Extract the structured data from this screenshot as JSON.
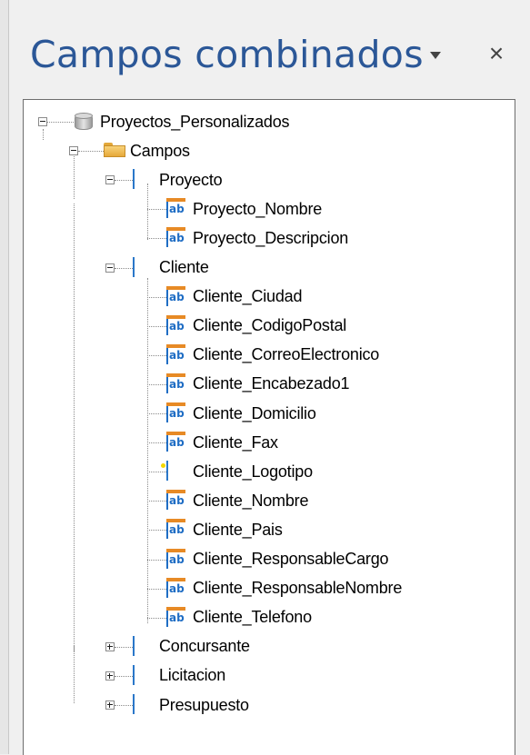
{
  "panel": {
    "title": "Campos combinados",
    "dropdown_icon": "chevron-down-icon",
    "close_label": "×"
  },
  "tree": {
    "root": {
      "label": "Proyectos_Personalizados",
      "icon": "database-icon"
    },
    "campos": {
      "label": "Campos",
      "icon": "folder-open-icon"
    },
    "proyecto": {
      "label": "Proyecto",
      "fields": [
        "Proyecto_Nombre",
        "Proyecto_Descripcion"
      ]
    },
    "cliente": {
      "label": "Cliente",
      "fields": [
        "Cliente_Ciudad",
        "Cliente_CodigoPostal",
        "Cliente_CorreoElectronico",
        "Cliente_Encabezado1",
        "Cliente_Domicilio",
        "Cliente_Fax",
        "Cliente_Logotipo",
        "Cliente_Nombre",
        "Cliente_Pais",
        "Cliente_ResponsableCargo",
        "Cliente_ResponsableNombre",
        "Cliente_Telefono"
      ]
    },
    "collapsed_tables": [
      "Concursante",
      "Licitacion",
      "Presupuesto"
    ],
    "ab_icon_text": "ab"
  }
}
